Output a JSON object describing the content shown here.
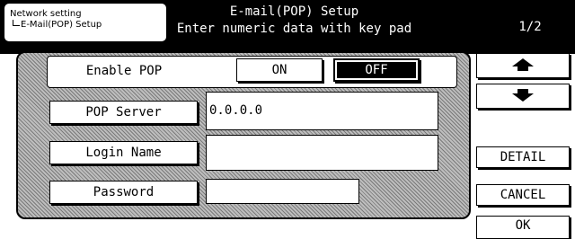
{
  "breadcrumb": {
    "line1": "Network setting",
    "line2": "E-Mail(POP) Setup"
  },
  "header": {
    "title": "E-mail(POP) Setup",
    "subtitle": "Enter numeric data with key pad",
    "page": "1/2"
  },
  "enable_pop": {
    "label": "Enable POP",
    "on_label": "ON",
    "off_label": "OFF",
    "selected": "OFF"
  },
  "fields": {
    "pop_server": {
      "label": "POP Server",
      "value": "0.0.0.0"
    },
    "login_name": {
      "label": "Login Name",
      "value": ""
    },
    "password": {
      "label": "Password",
      "value": ""
    }
  },
  "side": {
    "up_icon": "arrow-up-icon",
    "down_icon": "arrow-down-icon",
    "detail": "DETAIL",
    "cancel": "CANCEL",
    "ok": "OK"
  }
}
